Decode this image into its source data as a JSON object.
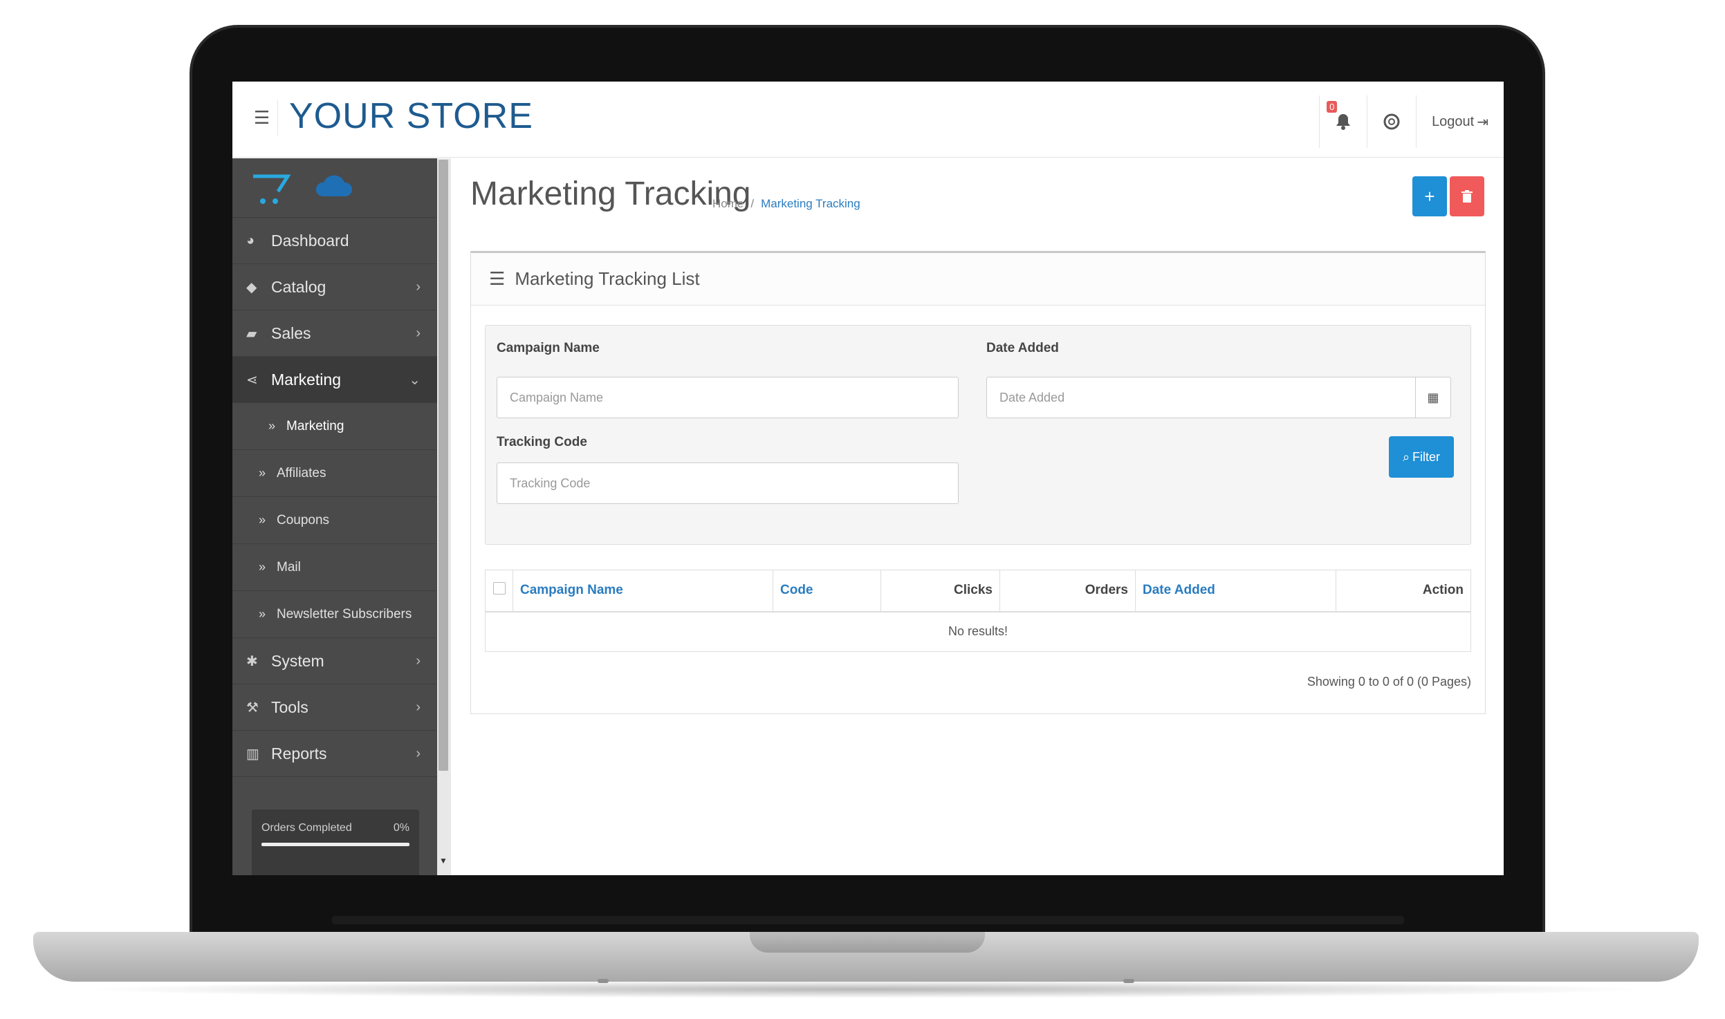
{
  "header": {
    "store_name": "YOUR STORE",
    "notification_count": "0",
    "logout_label": "Logout"
  },
  "sidebar": {
    "items": [
      {
        "label": "Dashboard"
      },
      {
        "label": "Catalog"
      },
      {
        "label": "Sales"
      },
      {
        "label": "Marketing"
      },
      {
        "label": "System"
      },
      {
        "label": "Tools"
      },
      {
        "label": "Reports"
      }
    ],
    "sub_items": [
      {
        "label": "Marketing"
      },
      {
        "label": "Affiliates"
      },
      {
        "label": "Coupons"
      },
      {
        "label": "Mail"
      },
      {
        "label": "Newsletter Subscribers"
      }
    ],
    "stats": {
      "label": "Orders Completed",
      "value": "0%",
      "progress": 1.0
    }
  },
  "page": {
    "title": "Marketing Tracking",
    "breadcrumb": [
      "Home",
      "Marketing Tracking"
    ]
  },
  "panel": {
    "title": "Marketing Tracking List",
    "filter": {
      "campaign_label": "Campaign Name",
      "campaign_placeholder": "Campaign Name",
      "date_label": "Date Added",
      "date_placeholder": "Date Added",
      "tracking_label": "Tracking Code",
      "tracking_placeholder": "Tracking Code",
      "filter_button": "Filter"
    },
    "table": {
      "headers": [
        "Campaign Name",
        "Code",
        "Clicks",
        "Orders",
        "Date Added",
        "Action"
      ],
      "empty_text": "No results!"
    },
    "pagination": "Showing 0 to 0 of 0 (0 Pages)"
  }
}
